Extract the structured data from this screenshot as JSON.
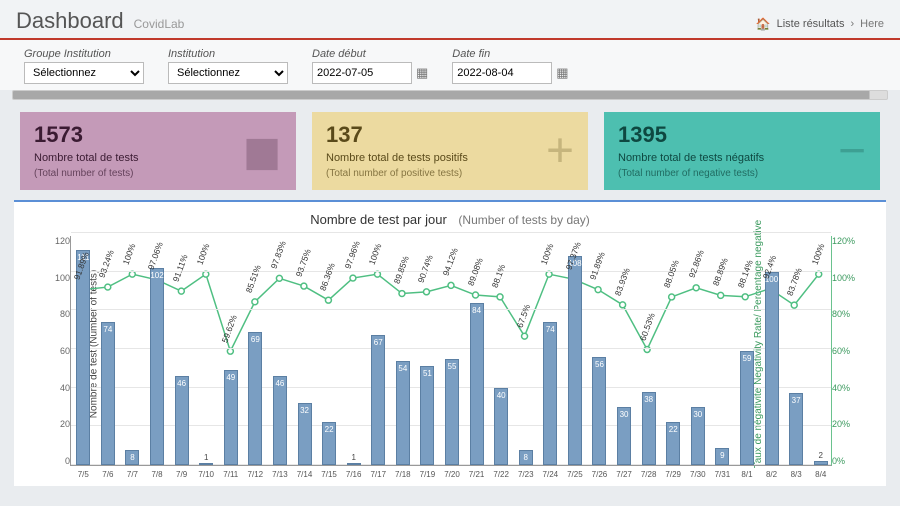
{
  "header": {
    "title": "Dashboard",
    "subtitle": "CovidLab",
    "breadcrumb_link": "Liste résultats",
    "breadcrumb_current": "Here"
  },
  "filters": {
    "group_label": "Groupe Institution",
    "group_value": "Sélectionnez",
    "inst_label": "Institution",
    "inst_value": "Sélectionnez",
    "date_start_label": "Date début",
    "date_start_value": "2022-07-05",
    "date_end_label": "Date fin",
    "date_end_value": "2022-08-04"
  },
  "cards": {
    "total": {
      "value": "1573",
      "label1": "Nombre total de tests",
      "label2": "(Total number of tests)"
    },
    "positive": {
      "value": "137",
      "label1": "Nombre total de tests positifs",
      "label2": "(Total number of positive tests)"
    },
    "negative": {
      "value": "1395",
      "label1": "Nombre total de tests négatifs",
      "label2": "(Total number of negative tests)"
    }
  },
  "chart_data": {
    "type": "bar",
    "title": "Nombre de test par jour",
    "subtitle": "(Number of tests by day)",
    "xlabel": "",
    "ylabel_left": "Nombre de test   (Number of tests)",
    "ylabel_right": "Taux de négativite\nNegativity Rate/ Percentage negative",
    "ylim_left": [
      0,
      120
    ],
    "ylim_right": [
      0,
      120
    ],
    "y_left_ticks": [
      0,
      20,
      40,
      60,
      80,
      100,
      120
    ],
    "y_right_ticks": [
      "0%",
      "20%",
      "40%",
      "60%",
      "80%",
      "100%",
      "120%"
    ],
    "categories": [
      "7/5",
      "7/6",
      "7/7",
      "7/8",
      "7/9",
      "7/10",
      "7/11",
      "7/12",
      "7/13",
      "7/14",
      "7/15",
      "7/16",
      "7/17",
      "7/18",
      "7/19",
      "7/20",
      "7/21",
      "7/22",
      "7/23",
      "7/24",
      "7/25",
      "7/26",
      "7/27",
      "7/28",
      "7/29",
      "7/30",
      "7/31",
      "8/1",
      "8/2",
      "8/3",
      "8/4"
    ],
    "series": [
      {
        "name": "Nombre de test",
        "type": "bar",
        "values": [
          111,
          74,
          8,
          102,
          46,
          1,
          49,
          69,
          46,
          32,
          22,
          1,
          67,
          54,
          51,
          55,
          84,
          40,
          8,
          74,
          108,
          56,
          30,
          38,
          22,
          30,
          9,
          59,
          100,
          37,
          2
        ]
      },
      {
        "name": "Taux de négativite",
        "type": "line",
        "unit": "%",
        "values": [
          91.89,
          93.24,
          100,
          97.06,
          91.11,
          100,
          59.62,
          85.51,
          97.83,
          93.75,
          86.36,
          97.96,
          100,
          89.85,
          90.74,
          94.12,
          89.08,
          88.1,
          67.5,
          100,
          97.37,
          91.89,
          83.93,
          60.53,
          88.05,
          92.86,
          88.89,
          88.14,
          92.4,
          83.78,
          100
        ]
      }
    ]
  }
}
